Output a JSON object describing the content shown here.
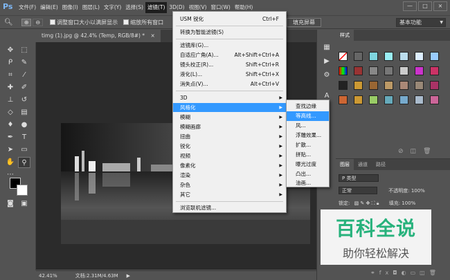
{
  "app": {
    "logo": "Ps"
  },
  "menubar": {
    "items": [
      "文件(F)",
      "编辑(E)",
      "图像(I)",
      "图层(L)",
      "文字(Y)",
      "选择(S)",
      "滤镜(T)",
      "3D(D)",
      "视图(V)",
      "窗口(W)",
      "帮助(H)"
    ],
    "window_buttons": [
      "—",
      "□",
      "×"
    ]
  },
  "options": {
    "resize_label": "调整窗口大小以满屏显示",
    "zoom_all_label": "缩放所有窗口",
    "fill_screen": "填充屏幕",
    "workspace": "基本功能"
  },
  "document": {
    "tab_label": "timg (1).jpg @ 42.4% (Temp, RGB/8#) *",
    "zoom": "42.41%",
    "doc_size": "文档:2.31M/4.63M"
  },
  "filter_menu": {
    "items": [
      {
        "label": "USM 锐化",
        "shortcut": "Ctrl+F"
      },
      {
        "label": "转换为智能滤镜(S)",
        "shortcut": ""
      },
      {
        "label": "滤镜库(G)...",
        "shortcut": ""
      },
      {
        "label": "自适应广角(A)...",
        "shortcut": "Alt+Shift+Ctrl+A"
      },
      {
        "label": "镜头校正(R)...",
        "shortcut": "Shift+Ctrl+R"
      },
      {
        "label": "液化(L)...",
        "shortcut": "Shift+Ctrl+X"
      },
      {
        "label": "消失点(V)...",
        "shortcut": "Alt+Ctrl+V"
      },
      {
        "label": "3D",
        "shortcut": ""
      },
      {
        "label": "风格化",
        "shortcut": ""
      },
      {
        "label": "模糊",
        "shortcut": ""
      },
      {
        "label": "模糊画廊",
        "shortcut": ""
      },
      {
        "label": "扭曲",
        "shortcut": ""
      },
      {
        "label": "锐化",
        "shortcut": ""
      },
      {
        "label": "视频",
        "shortcut": ""
      },
      {
        "label": "像素化",
        "shortcut": ""
      },
      {
        "label": "渲染",
        "shortcut": ""
      },
      {
        "label": "杂色",
        "shortcut": ""
      },
      {
        "label": "其它",
        "shortcut": ""
      },
      {
        "label": "浏览联机滤镜...",
        "shortcut": ""
      }
    ]
  },
  "stylize_submenu": {
    "items": [
      "查找边缘",
      "等高线...",
      "风...",
      "浮雕效果...",
      "扩散...",
      "拼贴...",
      "曝光过度",
      "凸出...",
      "油画..."
    ]
  },
  "panels": {
    "styles_tab": "样式",
    "layers_tabs": [
      "图层",
      "通道",
      "路径"
    ],
    "kind_label": "P 类型",
    "blend_mode": "正常",
    "opacity_label": "不透明度: 100%",
    "lock_label": "锁定:",
    "fill_label": "填充: 100%"
  },
  "watermark": {
    "line1": "百科全说",
    "line2": "助你轻松解决"
  },
  "colors": {
    "highlight": "#3399ff",
    "watermark_green": "#27b27c",
    "ui_dark": "#535353"
  }
}
